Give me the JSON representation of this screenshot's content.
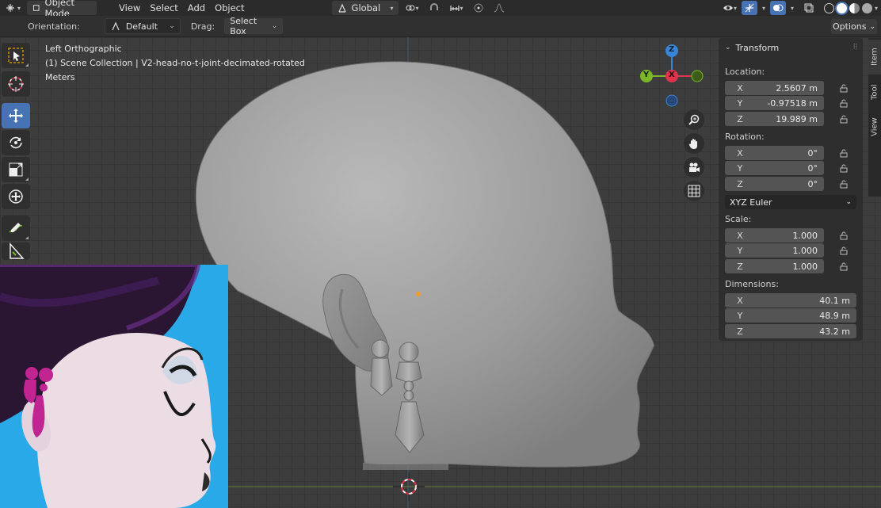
{
  "header": {
    "mode": "Object Mode",
    "menus": [
      "View",
      "Select",
      "Add",
      "Object"
    ],
    "transform_orientation": "Global"
  },
  "toolsettings": {
    "orientation_label": "Orientation:",
    "orientation_value": "Default",
    "drag_label": "Drag:",
    "drag_value": "Select Box",
    "options_label": "Options"
  },
  "viewport": {
    "view_name": "Left Orthographic",
    "collection": "(1) Scene Collection | V2-head-no-t-joint-decimated-rotated",
    "units": "Meters"
  },
  "gizmo": {
    "z": "Z",
    "y": "Y",
    "x": "X"
  },
  "npanel": {
    "section": "Transform",
    "location_label": "Location:",
    "location": [
      {
        "axis": "X",
        "value": "2.5607 m"
      },
      {
        "axis": "Y",
        "value": "-0.97518 m"
      },
      {
        "axis": "Z",
        "value": "19.989 m"
      }
    ],
    "rotation_label": "Rotation:",
    "rotation": [
      {
        "axis": "X",
        "value": "0°"
      },
      {
        "axis": "Y",
        "value": "0°"
      },
      {
        "axis": "Z",
        "value": "0°"
      }
    ],
    "rotation_mode": "XYZ Euler",
    "scale_label": "Scale:",
    "scale": [
      {
        "axis": "X",
        "value": "1.000"
      },
      {
        "axis": "Y",
        "value": "1.000"
      },
      {
        "axis": "Z",
        "value": "1.000"
      }
    ],
    "dimensions_label": "Dimensions:",
    "dimensions": [
      {
        "axis": "X",
        "value": "40.1 m"
      },
      {
        "axis": "Y",
        "value": "48.9 m"
      },
      {
        "axis": "Z",
        "value": "43.2 m"
      }
    ]
  },
  "sidetabs": [
    "Item",
    "Tool",
    "View"
  ],
  "colors": {
    "accent": "#4772b3",
    "axis_x": "#e0344c",
    "axis_y": "#7cb72a",
    "axis_z": "#3a86d6"
  }
}
